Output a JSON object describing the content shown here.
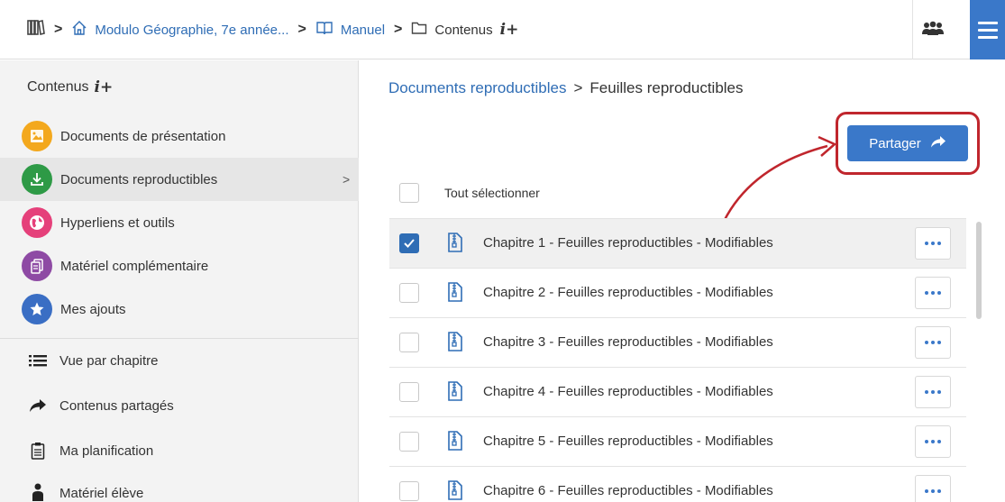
{
  "topbar": {
    "breadcrumb": [
      {
        "label": "Modulo Géographie, 7e année...",
        "icon": "home-icon"
      },
      {
        "label": "Manuel",
        "icon": "book-icon"
      },
      {
        "label": "Contenus",
        "icon": "folder-icon",
        "suffix": "i+"
      }
    ]
  },
  "sidebar": {
    "title": "Contenus",
    "title_suffix": "i+",
    "categories": [
      {
        "label": "Documents de présentation",
        "color": "#f3a81d",
        "icon": "image-icon"
      },
      {
        "label": "Documents reproductibles",
        "color": "#2e9a46",
        "icon": "download-icon",
        "active": true
      },
      {
        "label": "Hyperliens et outils",
        "color": "#e5407a",
        "icon": "globe-icon"
      },
      {
        "label": "Matériel complémentaire",
        "color": "#8e4aa4",
        "icon": "documents-icon"
      },
      {
        "label": "Mes ajouts",
        "color": "#3a6ec4",
        "icon": "star-icon"
      }
    ],
    "links": [
      {
        "label": "Vue par chapitre",
        "icon": "list-icon"
      },
      {
        "label": "Contenus partagés",
        "icon": "share-arrow-icon"
      },
      {
        "label": "Ma planification",
        "icon": "clipboard-icon"
      },
      {
        "label": "Matériel élève",
        "icon": "person-icon"
      }
    ]
  },
  "main": {
    "breadcrumb_parent": "Documents reproductibles",
    "breadcrumb_current": "Feuilles reproductibles",
    "share_label": "Partager",
    "select_all_label": "Tout sélectionner",
    "rows": [
      {
        "label": "Chapitre 1 - Feuilles reproductibles - Modifiables",
        "checked": true
      },
      {
        "label": "Chapitre 2 - Feuilles reproductibles - Modifiables",
        "checked": false
      },
      {
        "label": "Chapitre 3 - Feuilles reproductibles - Modifiables",
        "checked": false
      },
      {
        "label": "Chapitre 4 - Feuilles reproductibles - Modifiables",
        "checked": false
      },
      {
        "label": "Chapitre 5 - Feuilles reproductibles - Modifiables",
        "checked": false
      },
      {
        "label": "Chapitre 6 - Feuilles reproductibles - Modifiables",
        "checked": false
      }
    ]
  },
  "colors": {
    "accent": "#3a78c9",
    "link": "#2f6db5",
    "annotation": "#c0262d"
  }
}
